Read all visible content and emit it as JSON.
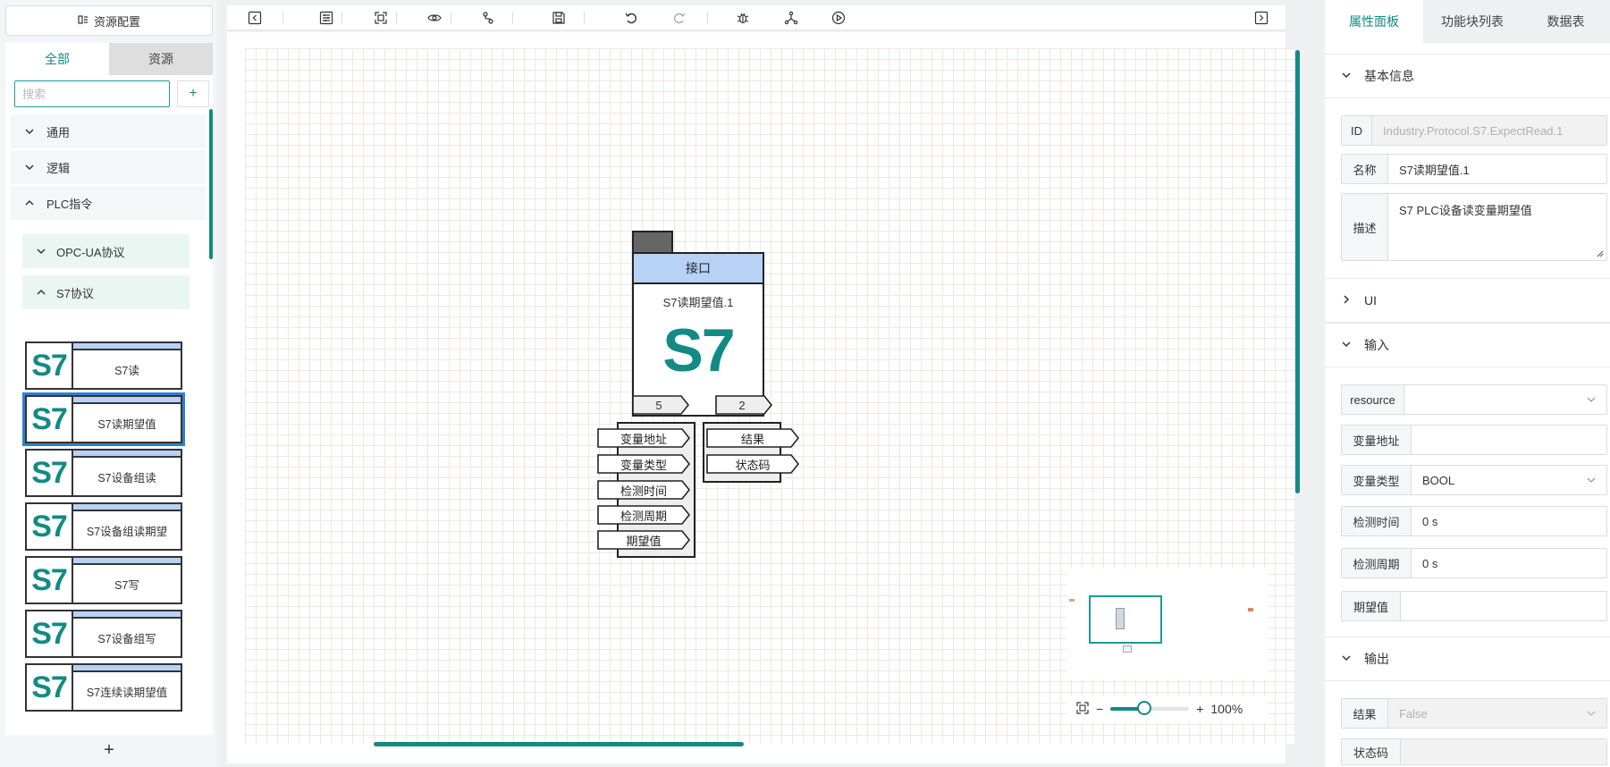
{
  "left_panel": {
    "resource_config_label": "资源配置",
    "tabs": [
      "全部",
      "资源"
    ],
    "search_placeholder": "搜索",
    "add_small": "+",
    "groups": [
      "通用",
      "逻辑",
      "PLC指令"
    ],
    "subgroups": [
      "OPC-UA协议",
      "S7协议"
    ],
    "blocks": [
      "S7读",
      "S7读期望值",
      "S7设备组读",
      "S7设备组读期望",
      "S7写",
      "S7设备组写",
      "S7连续读期望值"
    ],
    "block_icon_text": "S7",
    "bottom_add": "+"
  },
  "toolbar": {
    "icons": [
      "collapse-left-icon",
      "settings-panel-icon",
      "fit-view-icon",
      "preview-eye-icon",
      "connect-icon",
      "save-icon",
      "undo-icon",
      "redo-icon",
      "debug-bug-icon",
      "network-icon",
      "run-play-icon",
      "collapse-right-icon"
    ]
  },
  "node": {
    "header": "接口",
    "name": "S7读期望值.1",
    "big_text": "S7",
    "input_count": "5",
    "output_count": "2",
    "inputs": [
      "变量地址",
      "变量类型",
      "检测时间",
      "检测周期",
      "期望值"
    ],
    "outputs": [
      "结果",
      "状态码"
    ]
  },
  "minimap": {
    "zoom_label": "100%",
    "zoom_level": 0.43,
    "minus": "−",
    "plus": "+"
  },
  "right_panel": {
    "tabs": [
      "属性面板",
      "功能块列表",
      "数据表"
    ],
    "sections": {
      "basic": "基本信息",
      "ui": "UI",
      "input": "输入",
      "output": "输出"
    },
    "basic_fields": {
      "id_label": "ID",
      "id_value": "Industry.Protocol.S7.ExpectRead.1",
      "name_label": "名称",
      "name_value": "S7读期望值.1",
      "desc_label": "描述",
      "desc_value": "S7 PLC设备读变量期望值"
    },
    "input_fields": [
      {
        "label": "resource",
        "value": ""
      },
      {
        "label": "变量地址",
        "value": ""
      },
      {
        "label": "变量类型",
        "value": "BOOL"
      },
      {
        "label": "检测时间",
        "value": "0 s"
      },
      {
        "label": "检测周期",
        "value": "0 s"
      },
      {
        "label": "期望值",
        "value": ""
      }
    ],
    "output_fields": [
      {
        "label": "结果",
        "value": "False"
      },
      {
        "label": "状态码",
        "value": ""
      }
    ]
  },
  "colors": {
    "accent": "#138a84",
    "node_header": "#b7d2f5",
    "selected_outline": "#2d7fd6"
  }
}
